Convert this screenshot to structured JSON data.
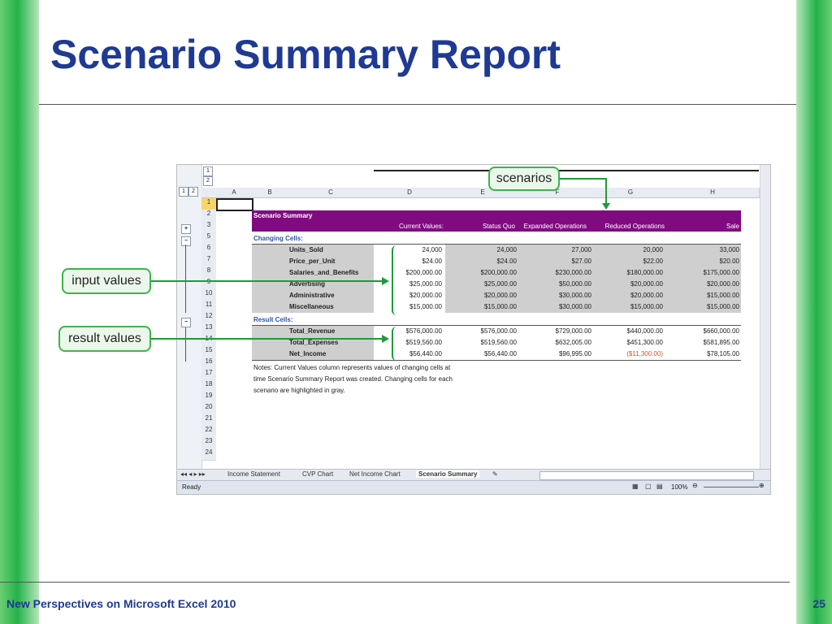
{
  "slide": {
    "title": "Scenario Summary Report",
    "footer_left": "New Perspectives on Microsoft Excel 2010",
    "page_number": "25",
    "colors": {
      "title": "#1f3a93",
      "accent_green": "#24b24a",
      "purple_header": "#800a80"
    }
  },
  "callouts": {
    "scenarios": "scenarios",
    "input_values": "input values",
    "result_values": "result values"
  },
  "excel": {
    "outline_levels": [
      "1",
      "2"
    ],
    "col_outline_levels": [
      "1",
      "2"
    ],
    "columns": [
      "A",
      "B",
      "C",
      "D",
      "E",
      "F",
      "G",
      "H"
    ],
    "rows": [
      "1",
      "2",
      "3",
      "5",
      "6",
      "7",
      "8",
      "9",
      "10",
      "11",
      "12",
      "13",
      "14",
      "15",
      "16",
      "17",
      "18",
      "19",
      "20",
      "21",
      "22",
      "23",
      "24"
    ],
    "header_title": "Scenario Summary",
    "header_cols": [
      "Current Values:",
      "Status Quo",
      "Expanded Operations",
      "Reduced Operations",
      "Sale"
    ],
    "changing_label": "Changing Cells:",
    "changing": [
      {
        "name": "Units_Sold",
        "values": [
          "24,000",
          "24,000",
          "27,000",
          "20,000",
          "33,000"
        ]
      },
      {
        "name": "Price_per_Unit",
        "values": [
          "$24.00",
          "$24.00",
          "$27.00",
          "$22.00",
          "$20.00"
        ]
      },
      {
        "name": "Salaries_and_Benefits",
        "values": [
          "$200,000.00",
          "$200,000.00",
          "$230,000.00",
          "$180,000.00",
          "$175,000.00"
        ]
      },
      {
        "name": "Advertising",
        "values": [
          "$25,000.00",
          "$25,000.00",
          "$50,000.00",
          "$20,000.00",
          "$20,000.00"
        ]
      },
      {
        "name": "Administrative",
        "values": [
          "$20,000.00",
          "$20,000.00",
          "$30,000.00",
          "$20,000.00",
          "$15,000.00"
        ]
      },
      {
        "name": "Miscellaneous",
        "values": [
          "$15,000.00",
          "$15,000.00",
          "$30,000.00",
          "$15,000.00",
          "$15,000.00"
        ]
      }
    ],
    "result_label": "Result Cells:",
    "results": [
      {
        "name": "Total_Revenue",
        "values": [
          "$576,000.00",
          "$576,000.00",
          "$729,000.00",
          "$440,000.00",
          "$660,000.00"
        ]
      },
      {
        "name": "Total_Expenses",
        "values": [
          "$519,560.00",
          "$519,560.00",
          "$632,005.00",
          "$451,300.00",
          "$581,895.00"
        ]
      },
      {
        "name": "Net_Income",
        "values": [
          "$56,440.00",
          "$56,440.00",
          "$96,995.00",
          "($11,300.00)",
          "$78,105.00"
        ]
      }
    ],
    "notes": [
      "Notes:  Current Values column represents values of changing cells at",
      "time Scenario Summary Report was created.  Changing cells for each",
      "scenario are highlighted in gray."
    ],
    "sheet_tabs": [
      "Income Statement",
      "CVP Chart",
      "Net Income Chart",
      "Scenario Summary"
    ],
    "status": {
      "ready": "Ready",
      "zoom": "100%"
    }
  }
}
